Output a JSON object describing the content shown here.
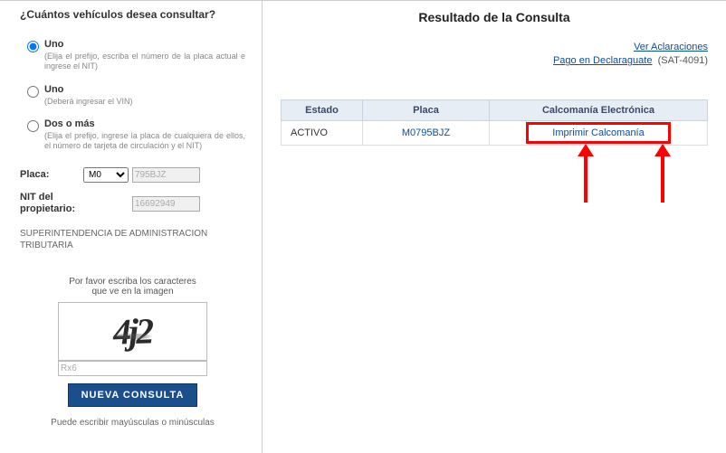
{
  "sidebar": {
    "title": "¿Cuántos vehículos desea consultar?",
    "options": [
      {
        "label": "Uno",
        "desc": "(Elija el prefijo, escriba el número de la placa actual e ingrese el NIT)"
      },
      {
        "label": "Uno",
        "desc": "(Deberá ingresar el VIN)"
      },
      {
        "label": "Dos o más",
        "desc": "(Elija el prefijo, ingrese la placa de cualquiera de ellos, el número de tarjeta de circulación y el NIT)"
      }
    ],
    "placa_label": "Placa:",
    "placa_prefix": "M0",
    "placa_value": "795BJZ",
    "nit_label": "NIT del propietario:",
    "nit_value": "16692949",
    "org": "SUPERINTENDENCIA DE ADMINISTRACION TRIBUTARIA",
    "captcha": {
      "prompt1": "Por favor escriba los caracteres",
      "prompt2": "que ve en la imagen",
      "image_text": "4j2",
      "input_placeholder": "Rx6"
    },
    "button": "NUEVA CONSULTA",
    "note": "Puede escribir mayúsculas o minúsculas"
  },
  "main": {
    "title": "Resultado de la Consulta",
    "links": {
      "aclaraciones": "Ver Aclaraciones",
      "pago": "Pago en Declaraguate",
      "code": "(SAT-4091)"
    },
    "table": {
      "headers": {
        "estado": "Estado",
        "placa": "Placa",
        "calcomania": "Calcomanía Electrónica"
      },
      "row": {
        "estado": "ACTIVO",
        "placa": "M0795BJZ",
        "imprimir": "Imprimir Calcomanía"
      }
    }
  }
}
